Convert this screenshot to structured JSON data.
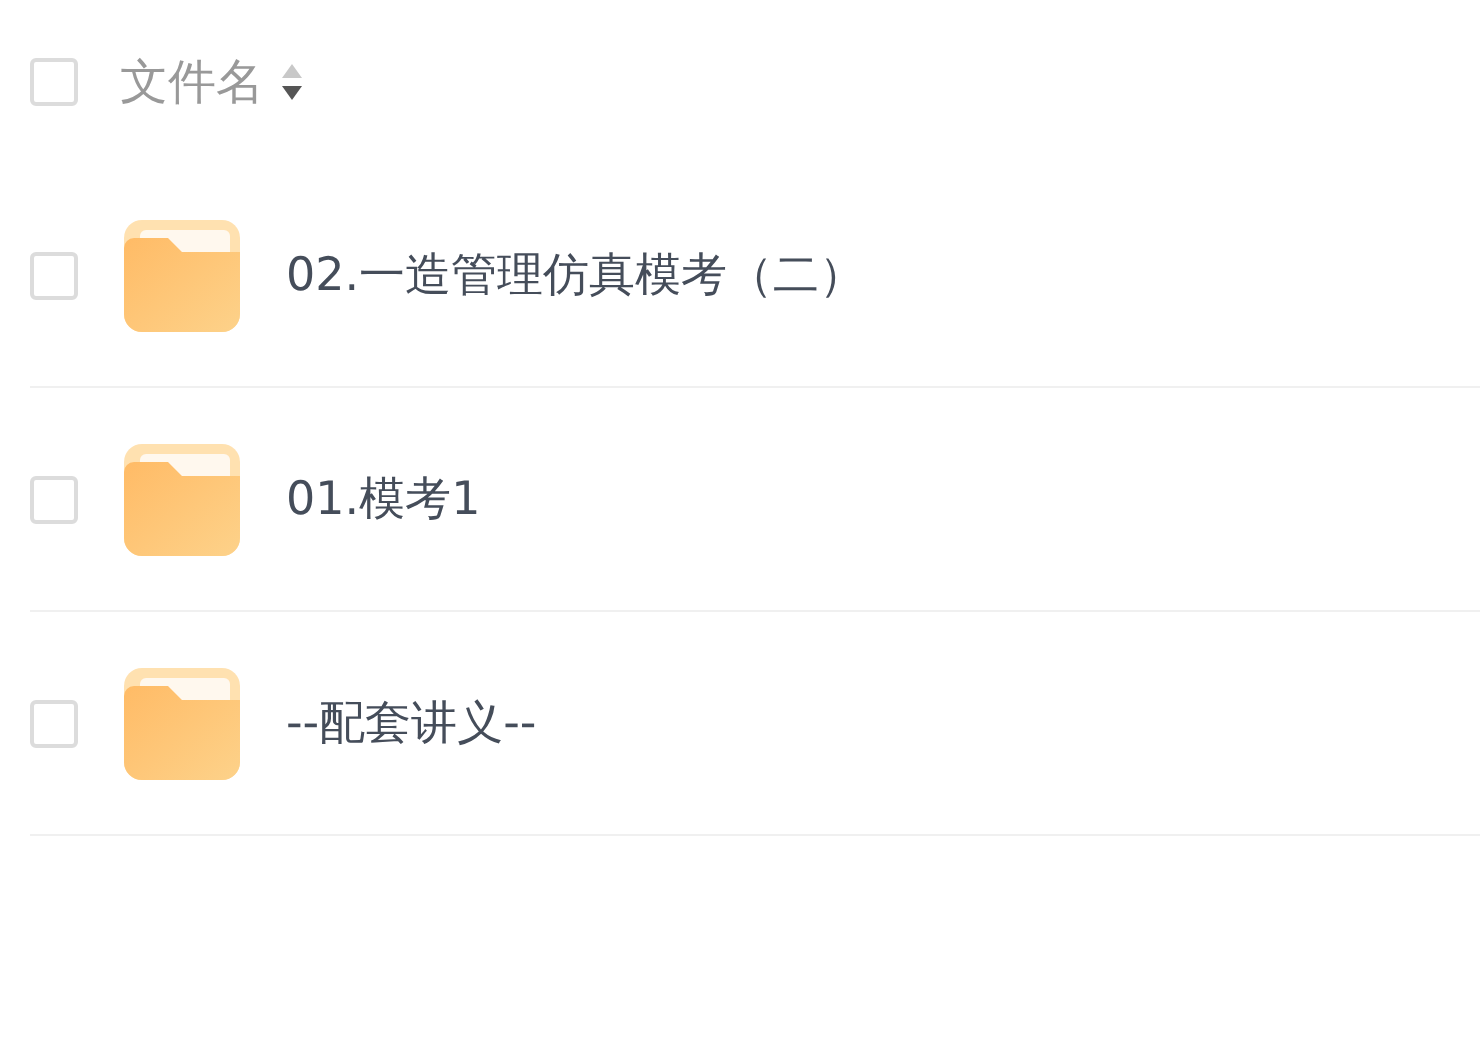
{
  "header": {
    "checked": false,
    "label": "文件名",
    "sort_descending": true
  },
  "files": [
    {
      "name": "02.一造管理仿真模考（二）",
      "checked": false
    },
    {
      "name": "01.模考1",
      "checked": false
    },
    {
      "name": "--配套讲义--",
      "checked": false
    }
  ]
}
